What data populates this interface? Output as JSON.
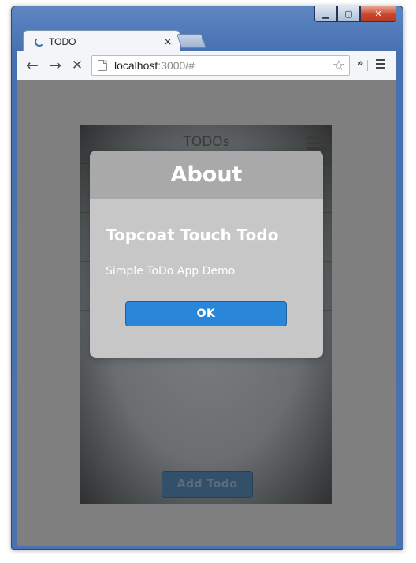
{
  "browser": {
    "tab": {
      "title": "TODO",
      "close": "×"
    },
    "toolbar": {
      "back": "←",
      "forward": "→",
      "stop": "✕",
      "url_host": "localhost",
      "url_rest": ":3000/#",
      "star": "☆",
      "extensions_chevron": "»"
    },
    "window": {
      "minimize": "▁",
      "maximize": "▢",
      "close": "✕"
    }
  },
  "app": {
    "header": {
      "title": "TODOs"
    },
    "add_button_label": "Add Todo"
  },
  "modal": {
    "title": "About",
    "heading": "Topcoat Touch Todo",
    "text": "Simple ToDo App Demo",
    "ok_label": "OK"
  },
  "colors": {
    "viewport_bg": "#7f7f7f",
    "modal_bg": "#c7c7c7",
    "modal_header_bg": "#a9a9a9",
    "ok_button": "#2986d8"
  }
}
